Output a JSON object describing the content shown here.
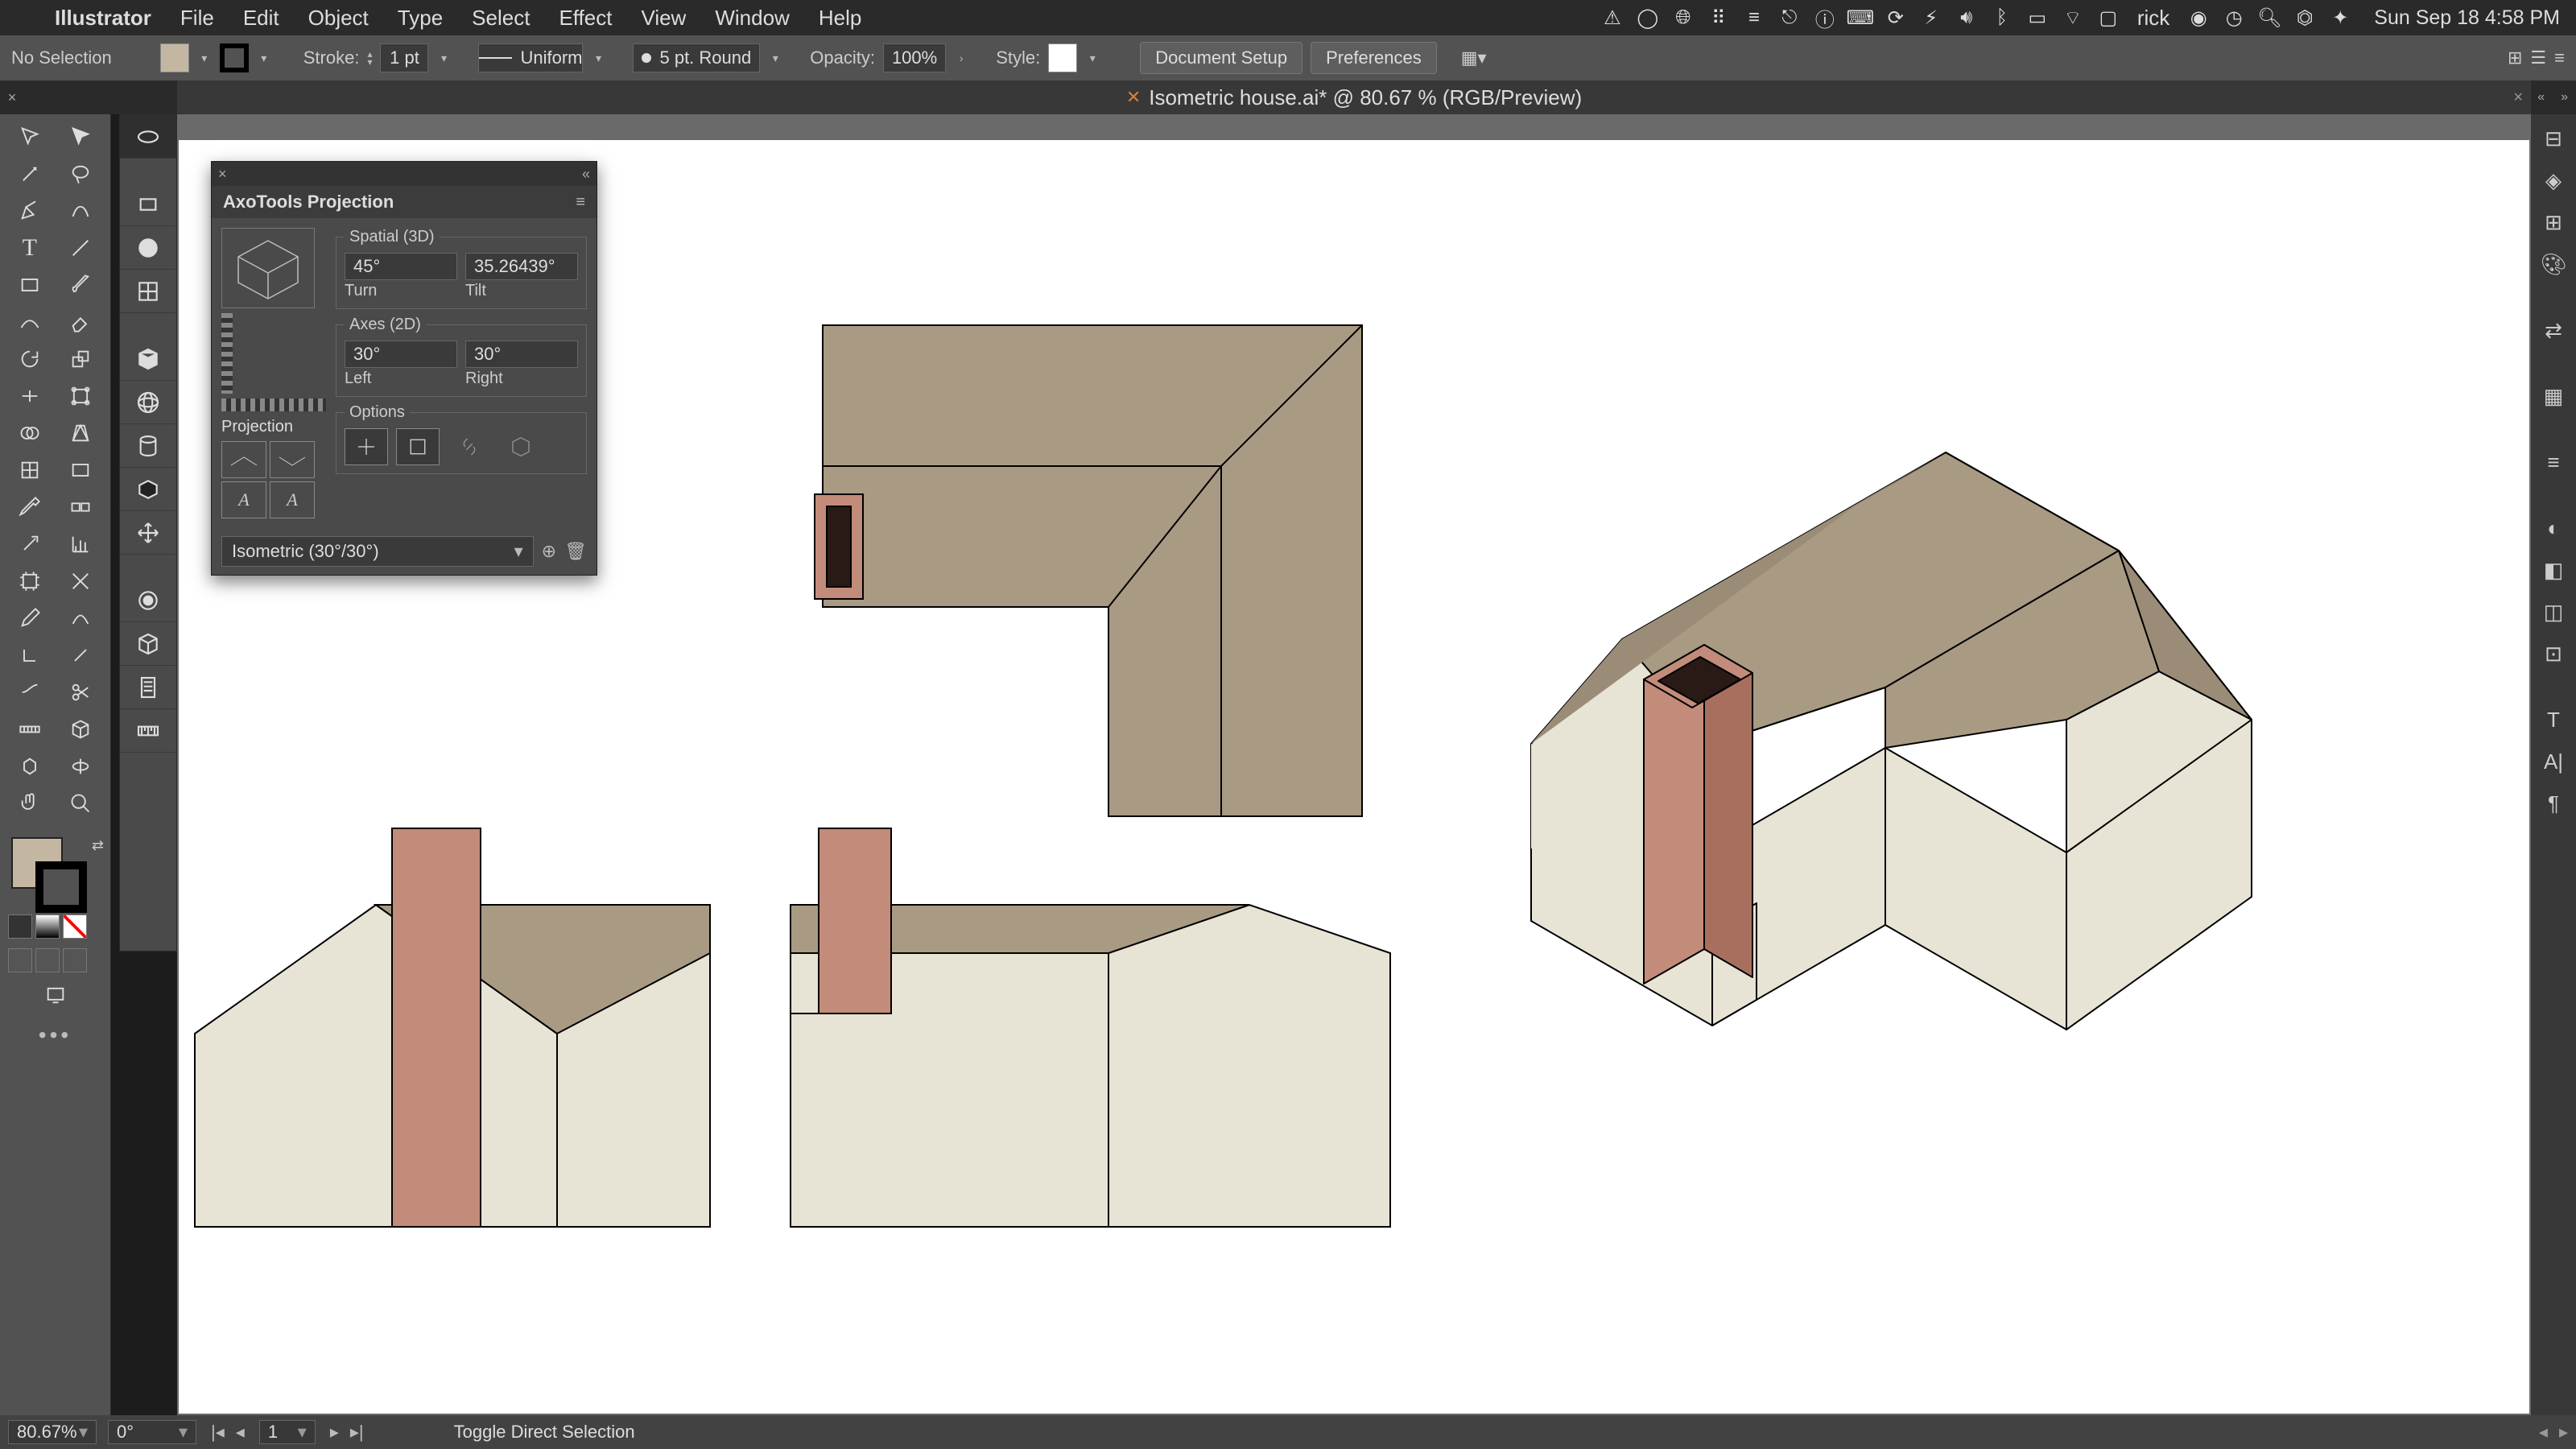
{
  "menubar": {
    "app": "Illustrator",
    "items": [
      "File",
      "Edit",
      "Object",
      "Type",
      "Select",
      "Effect",
      "View",
      "Window",
      "Help"
    ],
    "user": "rick",
    "clock": "Sun Sep 18  4:58 PM"
  },
  "controlbar": {
    "selection": "No Selection",
    "fill_color": "#c4b7a2",
    "stroke_color": "#000000",
    "stroke_label": "Stroke:",
    "stroke_weight": "1 pt",
    "stroke_profile": "Uniform",
    "brush_label": "5 pt. Round",
    "opacity_label": "Opacity:",
    "opacity_value": "100%",
    "style_label": "Style:",
    "doc_setup": "Document Setup",
    "prefs": "Preferences"
  },
  "document": {
    "title": "Isometric house.ai* @ 80.67 % (RGB/Preview)"
  },
  "axotools": {
    "title": "AxoTools Projection",
    "spatial_legend": "Spatial (3D)",
    "turn_value": "45°",
    "turn_label": "Turn",
    "tilt_value": "35.26439°",
    "tilt_label": "Tilt",
    "axes_legend": "Axes (2D)",
    "left_value": "30°",
    "left_label": "Left",
    "right_value": "30°",
    "right_label": "Right",
    "projection_label": "Projection",
    "options_legend": "Options",
    "preset": "Isometric (30°/30°)"
  },
  "status": {
    "zoom": "80.67%",
    "rotation": "0°",
    "artboard": "1",
    "hint": "Toggle Direct Selection"
  },
  "colors": {
    "roof": "#a99a84",
    "wall": "#e7e3d5",
    "roof_dark": "#9a8c77",
    "chimney": "#c38b7a",
    "chimney_dark": "#a86f5e",
    "chimney_top": "#2a1a16"
  }
}
